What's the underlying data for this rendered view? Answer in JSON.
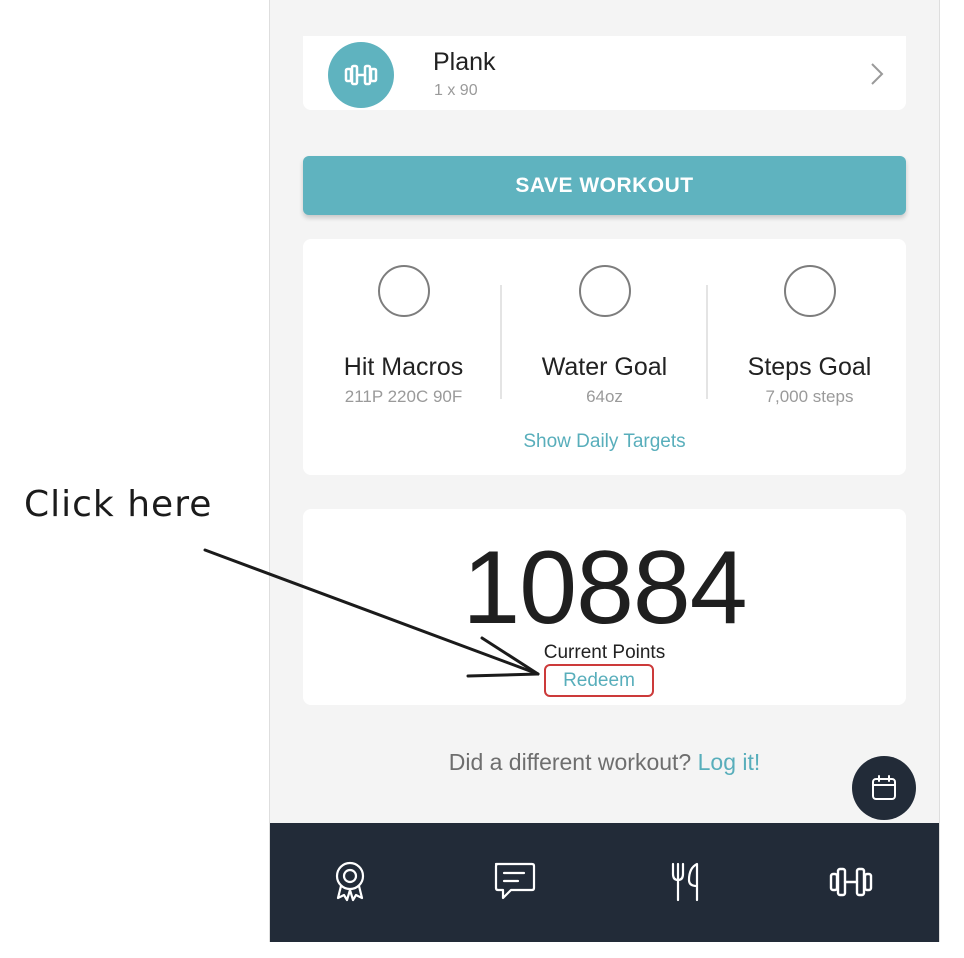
{
  "exercise": {
    "name": "Plank",
    "sets": "1 x 90",
    "icon": "dumbbell-icon"
  },
  "save_button_label": "SAVE WORKOUT",
  "goals": [
    {
      "title": "Hit Macros",
      "subtitle": "211P  220C 90F"
    },
    {
      "title": "Water Goal",
      "subtitle": "64oz"
    },
    {
      "title": "Steps Goal",
      "subtitle": "7,000 steps"
    }
  ],
  "show_targets_label": "Show Daily Targets",
  "points": {
    "value": "10884",
    "label": "Current Points",
    "redeem_label": "Redeem"
  },
  "log_prompt": {
    "text": "Did a different workout? ",
    "link": "Log it!"
  },
  "bottom_nav": [
    "award-icon",
    "chat-icon",
    "fork-knife-icon",
    "dumbbell-icon"
  ],
  "annotation": {
    "text": "Click here",
    "highlight_color": "#cc3a3a"
  },
  "colors": {
    "accent": "#5fb3bf",
    "link": "#58aebb",
    "nav": "#222b38"
  }
}
